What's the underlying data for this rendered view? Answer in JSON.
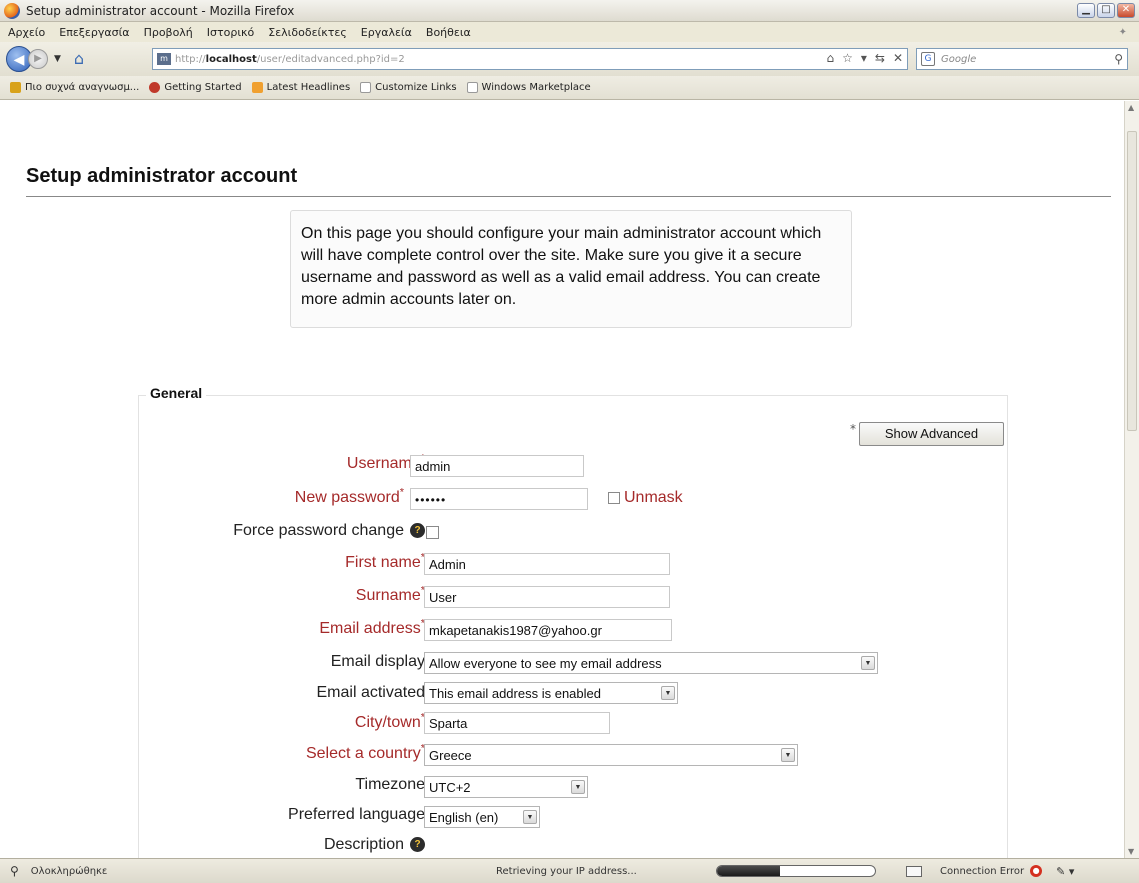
{
  "window": {
    "title": "Setup administrator account - Mozilla Firefox",
    "colors": {
      "required_label": "#a52a2a",
      "titlebar": "#dedbd0",
      "help_icon": "#f3c23c"
    }
  },
  "menu": [
    "Αρχείο",
    "Επεξεργασία",
    "Προβολή",
    "Ιστορικό",
    "Σελιδοδείκτες",
    "Εργαλεία",
    "Βοήθεια"
  ],
  "navigation": {
    "url_scheme": "http://",
    "url_host": "localhost",
    "url_path": "/user/editadvanced.php?id=2",
    "search_placeholder": "Google"
  },
  "bookmarks": [
    "Πιο συχνά αναγνωσμ...",
    "Getting Started",
    "Latest Headlines",
    "Customize Links",
    "Windows Marketplace"
  ],
  "page": {
    "title": "Setup administrator account",
    "intro": "On this page you should configure your main administrator account which will have complete control over the site. Make sure you give it a secure username and password as well as a valid email address. You can create more admin accounts later on.",
    "section_legend": "General",
    "show_advanced_label": "Show Advanced",
    "advanced_marker": "*"
  },
  "form": {
    "username": {
      "label": "Username",
      "value": "admin"
    },
    "new_password": {
      "label": "New password",
      "value": "••••••",
      "unmask_label": "Unmask"
    },
    "force_password_change": {
      "label": "Force password change",
      "checked": false
    },
    "first_name": {
      "label": "First name",
      "value": "Admin"
    },
    "surname": {
      "label": "Surname",
      "value": "User"
    },
    "email": {
      "label": "Email address",
      "value": "mkapetanakis1987@yahoo.gr"
    },
    "email_display": {
      "label": "Email display",
      "value": "Allow everyone to see my email address"
    },
    "email_activated": {
      "label": "Email activated",
      "value": "This email address is enabled"
    },
    "city": {
      "label": "City/town",
      "value": "Sparta"
    },
    "country": {
      "label": "Select a country",
      "value": "Greece"
    },
    "timezone": {
      "label": "Timezone",
      "value": "UTC+2"
    },
    "language": {
      "label": "Preferred language",
      "value": "English (en)"
    },
    "description": {
      "label": "Description"
    },
    "required_marker": "*"
  },
  "status": {
    "left": "Ολοκληρώθηκε",
    "middle": "Retrieving your IP address...",
    "progress_fraction": 0.4,
    "connection": "Connection Error"
  }
}
